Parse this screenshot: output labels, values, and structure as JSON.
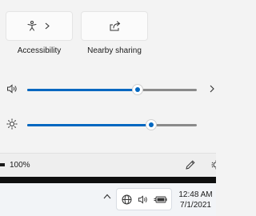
{
  "quick_actions": {
    "tiles": [
      {
        "label": "Accessibility",
        "icon": "accessibility-icon",
        "has_chevron": true
      },
      {
        "label": "Nearby sharing",
        "icon": "share-icon",
        "has_chevron": false
      }
    ]
  },
  "sliders": {
    "volume": {
      "icon": "speaker-icon",
      "value_percent": 65
    },
    "brightness": {
      "icon": "brightness-icon",
      "value_percent": 73
    }
  },
  "footer": {
    "battery_text": "100%",
    "edit_icon": "pencil-icon",
    "settings_icon": "gear-icon"
  },
  "taskbar": {
    "time": "12:48 AM",
    "date": "7/1/2021",
    "tray_icons": [
      "chevron-up-icon",
      "globe-icon",
      "speaker-icon",
      "battery-plug-icon"
    ]
  },
  "colors": {
    "accent": "#0067c0",
    "panel_bg": "#f3f3f3",
    "taskbar_bg": "#f2f4f7"
  }
}
